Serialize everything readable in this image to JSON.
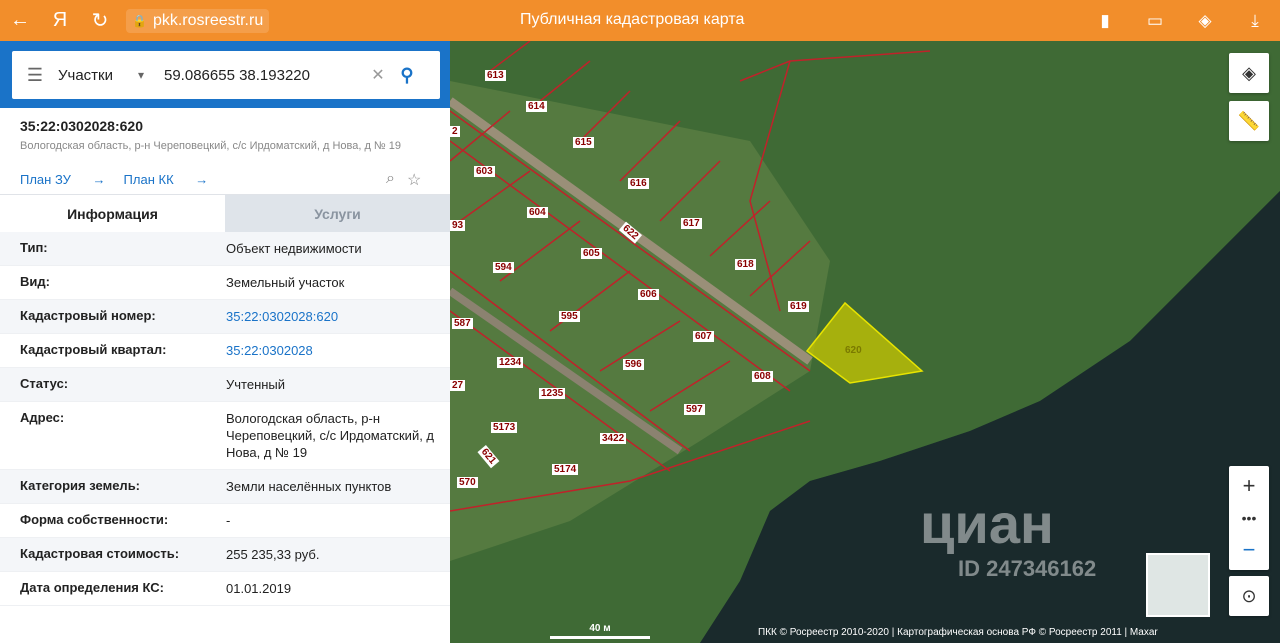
{
  "browser": {
    "back_icon": "arrow-left-icon",
    "yandex_label": "Я",
    "url": "pkk.rosreestr.ru",
    "page_title": "Публичная кадастровая карта"
  },
  "search": {
    "type": "Участки",
    "value": "59.086655 38.193220"
  },
  "object": {
    "cad_number": "35:22:0302028:620",
    "address": "Вологодская область, р-н Череповецкий, с/с Ирдоматский, д Нова, д № 19",
    "link_plan_zu": "План ЗУ",
    "link_plan_kk": "План КК"
  },
  "tabs": {
    "info": "Информация",
    "services": "Услуги"
  },
  "rows": [
    {
      "label": "Тип:",
      "value": "Объект недвижимости"
    },
    {
      "label": "Вид:",
      "value": "Земельный участок"
    },
    {
      "label": "Кадастровый номер:",
      "value": "35:22:0302028:620"
    },
    {
      "label": "Кадастровый квартал:",
      "value": "35:22:0302028"
    },
    {
      "label": "Статус:",
      "value": "Учтенный"
    },
    {
      "label": "Адрес:",
      "value": "Вологодская область, р-н Череповецкий, с/с Ирдоматский, д Нова, д № 19"
    },
    {
      "label": "Категория земель:",
      "value": "Земли населённых пунктов"
    },
    {
      "label": "Форма собственности:",
      "value": "-"
    },
    {
      "label": "Кадастровая стоимость:",
      "value": "255 235,33 руб."
    },
    {
      "label": "Дата определения КС:",
      "value": "01.01.2019"
    }
  ],
  "map": {
    "parcel_labels": [
      "613",
      "614",
      "615",
      "616",
      "617",
      "618",
      "619",
      "620",
      "622",
      "603",
      "604",
      "605",
      "606",
      "607",
      "608",
      "594",
      "595",
      "596",
      "597",
      "587",
      "1234",
      "1235",
      "3422",
      "5173",
      "5174",
      "570",
      "621",
      "27",
      "93",
      "2"
    ],
    "scale": "40 м",
    "attribution": "ПКК © Росреестр 2010-2020 | Картографическая основа РФ © Росреестр 2011 | Maxar",
    "watermark": "циан",
    "watermark_id": "ID 247346162"
  },
  "colors": {
    "accent_orange": "#f28e2b",
    "accent_blue": "#1a73c8",
    "selected_parcel": "#d8d400"
  }
}
